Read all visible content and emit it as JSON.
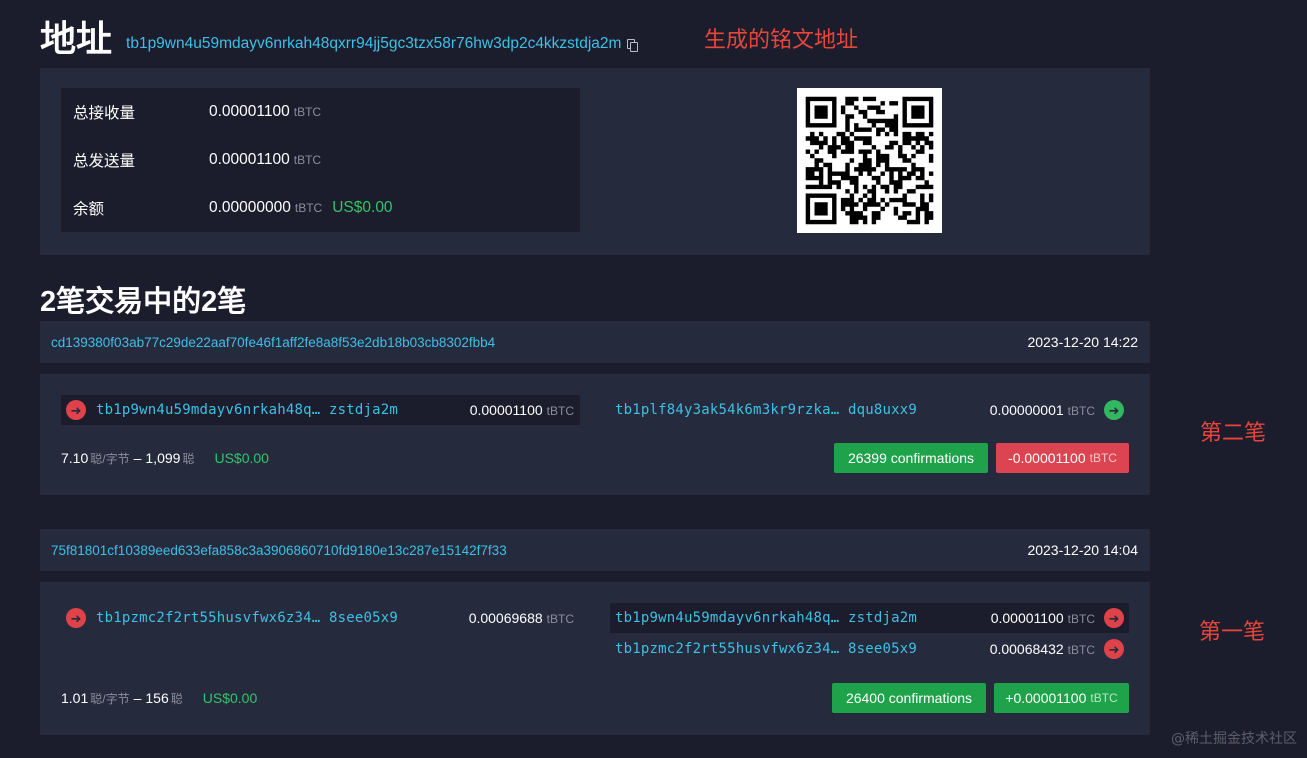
{
  "header": {
    "title": "地址",
    "address": "tb1p9wn4u59mdayv6nrkah48qxrr94jj5gc3tzx58r76hw3dp2c4kkzstdja2m",
    "annotation": "生成的铭文地址"
  },
  "summary": {
    "rows": [
      {
        "label": "总接收量",
        "value": "0.00001100",
        "unit": "tBTC",
        "usd": ""
      },
      {
        "label": "总发送量",
        "value": "0.00001100",
        "unit": "tBTC",
        "usd": ""
      },
      {
        "label": "余额",
        "value": "0.00000000",
        "unit": "tBTC",
        "usd": "US$0.00"
      }
    ]
  },
  "section_title": "2笔交易中的2笔",
  "transactions": [
    {
      "txid": "cd139380f03ab77c29de22aaf70fe46f1aff2fe8a8f53e2db18b03cb8302fbb4",
      "time": "2023-12-20 14:22",
      "inputs": [
        {
          "address": "tb1p9wn4u59mdayv6nrkah48q… zstdja2m",
          "amount": "0.00001100",
          "unit": "tBTC"
        }
      ],
      "outputs": [
        {
          "address": "tb1plf84y3ak54k6m3kr9rzka… dqu8uxx9",
          "amount": "0.00000001",
          "unit": "tBTC"
        }
      ],
      "fee_rate": "7.10",
      "fee_rate_unit": "聪/字节",
      "fee_sep": "–",
      "fee": "1,099",
      "fee_unit": "聪",
      "fee_usd": "US$0.00",
      "confirmations": "26399 confirmations",
      "net": "-0.00001100",
      "net_unit": "tBTC",
      "annotation": "第二笔"
    },
    {
      "txid": "75f81801cf10389eed633efa858c3a3906860710fd9180e13c287e15142f7f33",
      "time": "2023-12-20 14:04",
      "inputs": [
        {
          "address": "tb1pzmc2f2rt55husvfwx6z34… 8see05x9",
          "amount": "0.00069688",
          "unit": "tBTC"
        }
      ],
      "outputs": [
        {
          "address": "tb1p9wn4u59mdayv6nrkah48q… zstdja2m",
          "amount": "0.00001100",
          "unit": "tBTC"
        },
        {
          "address": "tb1pzmc2f2rt55husvfwx6z34… 8see05x9",
          "amount": "0.00068432",
          "unit": "tBTC"
        }
      ],
      "fee_rate": "1.01",
      "fee_rate_unit": "聪/字节",
      "fee_sep": "–",
      "fee": "156",
      "fee_unit": "聪",
      "fee_usd": "US$0.00",
      "confirmations": "26400 confirmations",
      "net": "+0.00001100",
      "net_unit": "tBTC",
      "annotation": "第一笔"
    }
  ],
  "watermark": "@稀土掘金技术社区",
  "colors": {
    "link": "#3dc0e6",
    "usd": "#33c46a",
    "annotation": "#e8453c",
    "badge_green": "#1fa34a",
    "badge_red": "#db4450"
  },
  "icons": {
    "copy": "copy-icon",
    "input_arrow": "arrow-right-circle-icon",
    "output_arrow": "arrow-right-circle-icon"
  }
}
